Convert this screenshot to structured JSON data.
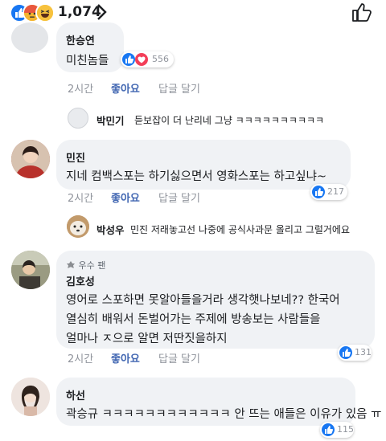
{
  "header": {
    "reaction_count": "1,074"
  },
  "comments": [
    {
      "name": "한승연",
      "text": "미친놈들",
      "time": "2시간",
      "like": "좋아요",
      "reply": "답글 달기",
      "reactions": "556"
    },
    {
      "name": "민진",
      "text": "지네 컴백스포는 하기싫으면서 영화스포는 하고싶냐~",
      "time": "2시간",
      "like": "좋아요",
      "reply": "답글 달기",
      "reactions": "217"
    },
    {
      "badge": "우수 팬",
      "name": "김호성",
      "lines": [
        "영어로 스포하면 못알아들을거라 생각햇나보네?? 한국어",
        "열심히 배워서 돈벌어가는 주제에 방송보는 사람들을",
        "얼마나 ㅈ으로 알면 저딴짓을하지"
      ],
      "time": "2시간",
      "like": "좋아요",
      "reply": "답글 달기",
      "reactions": "131"
    },
    {
      "name": "하선",
      "text": "곽승규 ㅋㅋㅋㅋㅋㅋㅋㅋㅋㅋㅋㅋ 안 뜨는 애들은 이유가 있음 ㅠ",
      "reactions": "115"
    }
  ],
  "replies": [
    {
      "name": "박민기",
      "text": "듣보잡이 더 난리네 그냥 ㅋㅋㅋㅋㅋㅋㅋㅋㅋㅋ"
    },
    {
      "name": "박성우",
      "text": "민진 저래놓고선 나중에 공식사과문 올리고 그럴거에요"
    }
  ]
}
